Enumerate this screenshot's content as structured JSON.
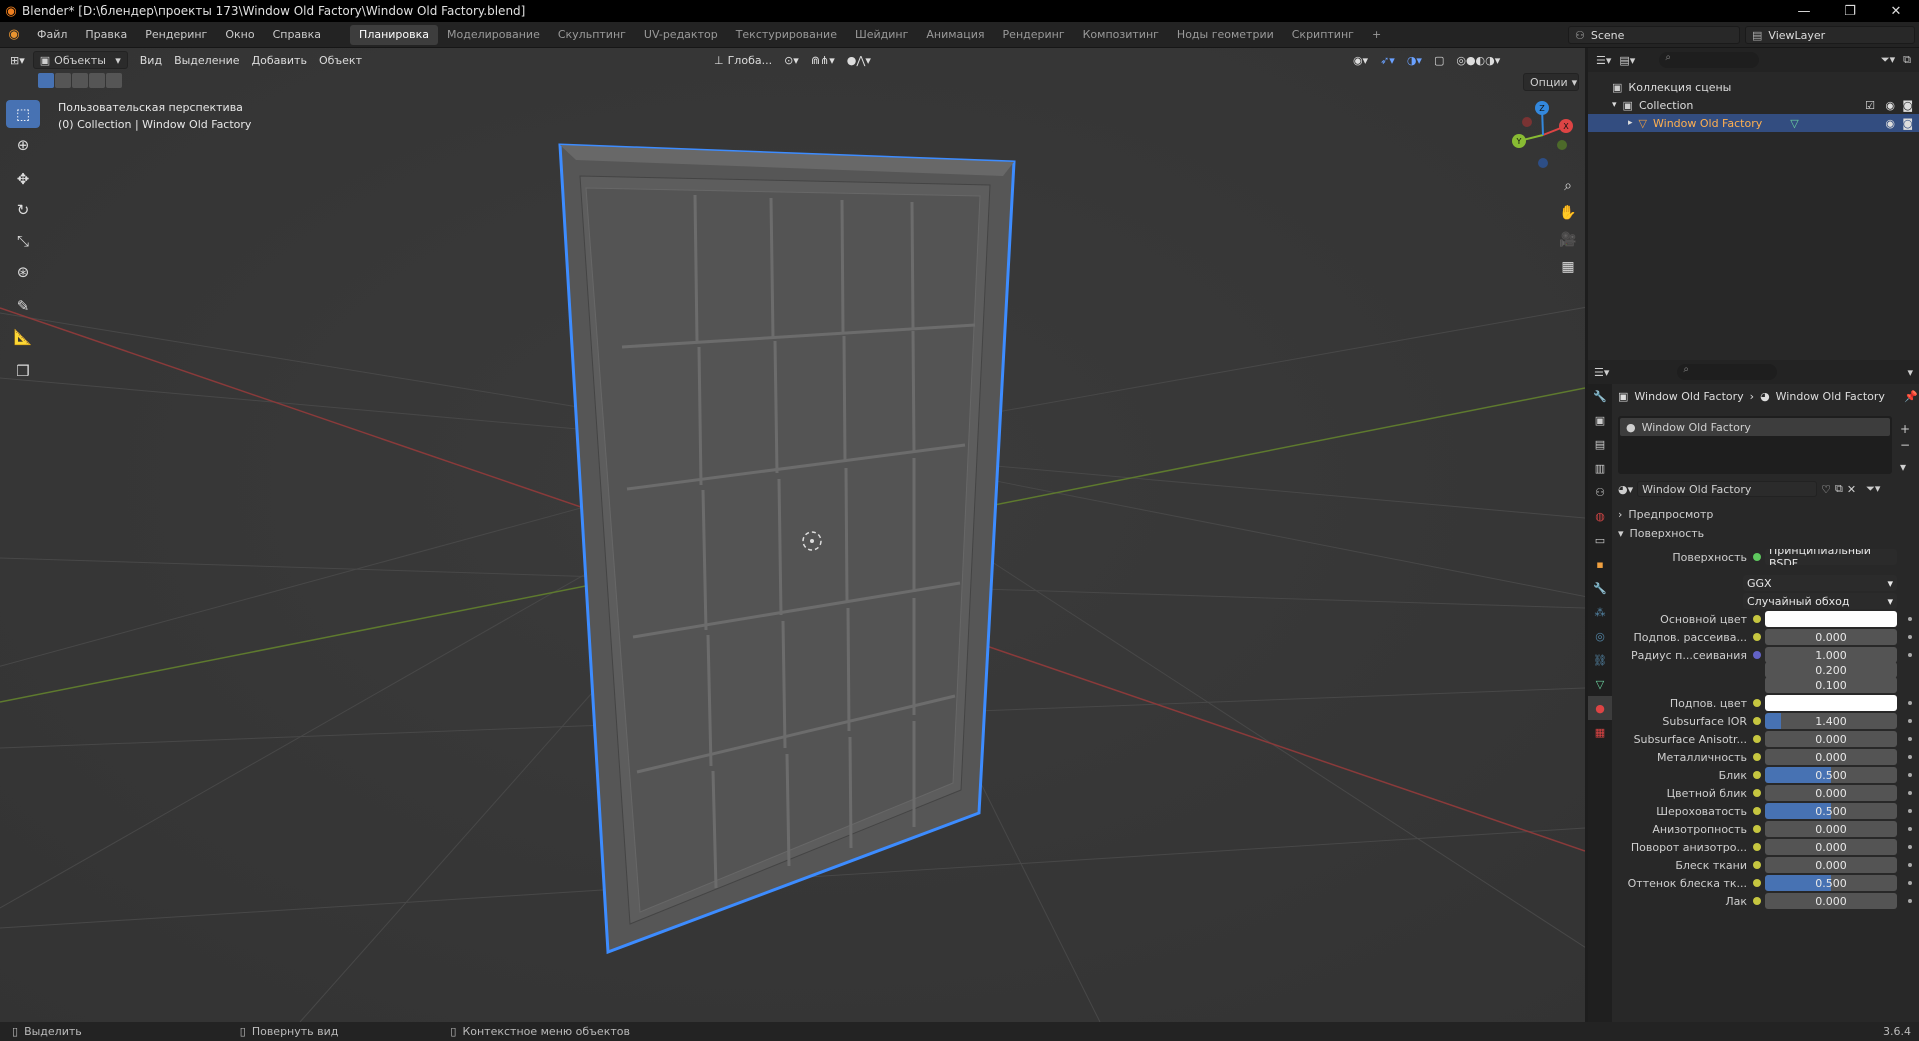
{
  "title": "Blender* [D:\\блендер\\проекты 173\\Window Old Factory\\Window Old Factory.blend]",
  "window_controls": [
    "—",
    "❐",
    "✕"
  ],
  "menu": [
    "Файл",
    "Правка",
    "Рендеринг",
    "Окно",
    "Справка"
  ],
  "workspaces": [
    "Планировка",
    "Моделирование",
    "Скульптинг",
    "UV-редактор",
    "Текстурирование",
    "Шейдинг",
    "Анимация",
    "Рендеринг",
    "Композитинг",
    "Ноды геометрии",
    "Скриптинг"
  ],
  "add_workspace": "+",
  "scene": "Scene",
  "view_layer": "ViewLayer",
  "viewport": {
    "mode": "Объекты",
    "menus": [
      "Вид",
      "Выделение",
      "Добавить",
      "Объект"
    ],
    "orientation": "Глоба...",
    "options": "Опции",
    "info_line1": "Пользовательская перспектива",
    "info_line2": "(0) Collection | Window Old Factory"
  },
  "gizmo": {
    "x": "X",
    "y": "Y",
    "z": "Z"
  },
  "outliner": {
    "rows": [
      {
        "label": "Коллекция сцены"
      },
      {
        "label": "Collection"
      },
      {
        "label": "Window Old Factory"
      }
    ]
  },
  "properties": {
    "breadcrumb_object": "Window Old Factory",
    "breadcrumb_material": "Window Old Factory",
    "slot": "Window Old Factory",
    "material_name": "Window Old Factory",
    "section_preview": "Предпросмотр",
    "section_surface": "Поверхность",
    "surface_label": "Поверхность",
    "surface_value": "Принципиальный BSDF",
    "distribution": "GGX",
    "subsurface_method": "Случайный обход",
    "rows": [
      {
        "label": "Основной цвет",
        "value": "",
        "color": "#ffffff"
      },
      {
        "label": "Подпов. рассеива...",
        "value": "0.000",
        "fill": 0
      },
      {
        "label": "Радиус п...сеивания",
        "value": "1.000",
        "fill": 0
      },
      {
        "label": "",
        "value": "0.200",
        "fill": 0
      },
      {
        "label": "",
        "value": "0.100",
        "fill": 0
      },
      {
        "label": "Подпов. цвет",
        "value": "",
        "color": "#ffffff"
      },
      {
        "label": "Subsurface IOR",
        "value": "1.400",
        "fill": 0.12
      },
      {
        "label": "Subsurface Anisotr...",
        "value": "0.000",
        "fill": 0
      },
      {
        "label": "Металличность",
        "value": "0.000",
        "fill": 0
      },
      {
        "label": "Блик",
        "value": "0.500",
        "fill": 0.5
      },
      {
        "label": "Цветной блик",
        "value": "0.000",
        "fill": 0
      },
      {
        "label": "Шероховатость",
        "value": "0.500",
        "fill": 0.5
      },
      {
        "label": "Анизотропность",
        "value": "0.000",
        "fill": 0
      },
      {
        "label": "Поворот анизотро...",
        "value": "0.000",
        "fill": 0
      },
      {
        "label": "Блеск ткани",
        "value": "0.000",
        "fill": 0
      },
      {
        "label": "Оттенок блеска тк...",
        "value": "0.500",
        "fill": 0.5
      },
      {
        "label": "Лак",
        "value": "0.000",
        "fill": 0
      }
    ]
  },
  "statusbar": {
    "select": "Выделить",
    "rotate": "Повернуть вид",
    "context": "Контекстное меню объектов",
    "version": "3.6.4"
  },
  "colors": {
    "accent": "#4772b3",
    "selection_outline": "#3d8cff",
    "x_axis": "#8a3a3a",
    "y_axis": "#5e7a2e"
  }
}
